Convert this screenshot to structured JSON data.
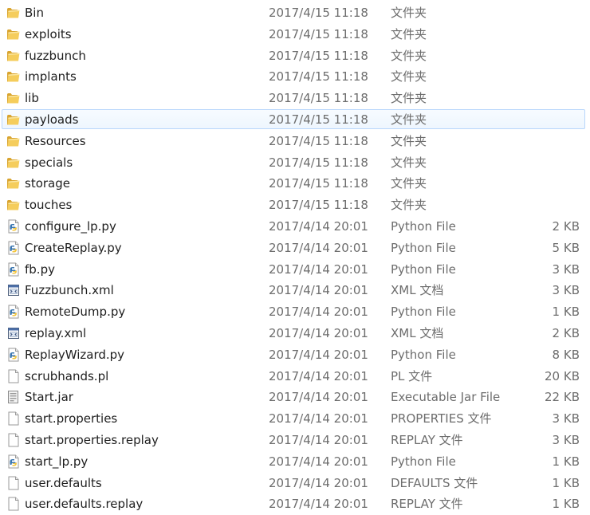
{
  "files": [
    {
      "name": "Bin",
      "date": "2017/4/15 11:18",
      "type": "文件夹",
      "size": "",
      "icon": "folder-icon"
    },
    {
      "name": "exploits",
      "date": "2017/4/15 11:18",
      "type": "文件夹",
      "size": "",
      "icon": "folder-icon"
    },
    {
      "name": "fuzzbunch",
      "date": "2017/4/15 11:18",
      "type": "文件夹",
      "size": "",
      "icon": "folder-icon"
    },
    {
      "name": "implants",
      "date": "2017/4/15 11:18",
      "type": "文件夹",
      "size": "",
      "icon": "folder-icon"
    },
    {
      "name": "lib",
      "date": "2017/4/15 11:18",
      "type": "文件夹",
      "size": "",
      "icon": "folder-icon"
    },
    {
      "name": "payloads",
      "date": "2017/4/15 11:18",
      "type": "文件夹",
      "size": "",
      "icon": "folder-icon",
      "hover": true
    },
    {
      "name": "Resources",
      "date": "2017/4/15 11:18",
      "type": "文件夹",
      "size": "",
      "icon": "folder-icon"
    },
    {
      "name": "specials",
      "date": "2017/4/15 11:18",
      "type": "文件夹",
      "size": "",
      "icon": "folder-icon"
    },
    {
      "name": "storage",
      "date": "2017/4/15 11:18",
      "type": "文件夹",
      "size": "",
      "icon": "folder-icon"
    },
    {
      "name": "touches",
      "date": "2017/4/15 11:18",
      "type": "文件夹",
      "size": "",
      "icon": "folder-icon"
    },
    {
      "name": "configure_lp.py",
      "date": "2017/4/14 20:01",
      "type": "Python File",
      "size": "2 KB",
      "icon": "python-file-icon"
    },
    {
      "name": "CreateReplay.py",
      "date": "2017/4/14 20:01",
      "type": "Python File",
      "size": "5 KB",
      "icon": "python-file-icon"
    },
    {
      "name": "fb.py",
      "date": "2017/4/14 20:01",
      "type": "Python File",
      "size": "3 KB",
      "icon": "python-file-icon"
    },
    {
      "name": "Fuzzbunch.xml",
      "date": "2017/4/14 20:01",
      "type": "XML 文档",
      "size": "3 KB",
      "icon": "xml-file-icon"
    },
    {
      "name": "RemoteDump.py",
      "date": "2017/4/14 20:01",
      "type": "Python File",
      "size": "1 KB",
      "icon": "python-file-icon"
    },
    {
      "name": "replay.xml",
      "date": "2017/4/14 20:01",
      "type": "XML 文档",
      "size": "2 KB",
      "icon": "xml-file-icon"
    },
    {
      "name": "ReplayWizard.py",
      "date": "2017/4/14 20:01",
      "type": "Python File",
      "size": "8 KB",
      "icon": "python-file-icon"
    },
    {
      "name": "scrubhands.pl",
      "date": "2017/4/14 20:01",
      "type": "PL 文件",
      "size": "20 KB",
      "icon": "blank-file-icon"
    },
    {
      "name": "Start.jar",
      "date": "2017/4/14 20:01",
      "type": "Executable Jar File",
      "size": "22 KB",
      "icon": "jar-file-icon"
    },
    {
      "name": "start.properties",
      "date": "2017/4/14 20:01",
      "type": "PROPERTIES 文件",
      "size": "3 KB",
      "icon": "blank-file-icon"
    },
    {
      "name": "start.properties.replay",
      "date": "2017/4/14 20:01",
      "type": "REPLAY 文件",
      "size": "3 KB",
      "icon": "blank-file-icon"
    },
    {
      "name": "start_lp.py",
      "date": "2017/4/14 20:01",
      "type": "Python File",
      "size": "1 KB",
      "icon": "python-file-icon"
    },
    {
      "name": "user.defaults",
      "date": "2017/4/14 20:01",
      "type": "DEFAULTS 文件",
      "size": "1 KB",
      "icon": "blank-file-icon"
    },
    {
      "name": "user.defaults.replay",
      "date": "2017/4/14 20:01",
      "type": "REPLAY 文件",
      "size": "1 KB",
      "icon": "blank-file-icon"
    }
  ]
}
